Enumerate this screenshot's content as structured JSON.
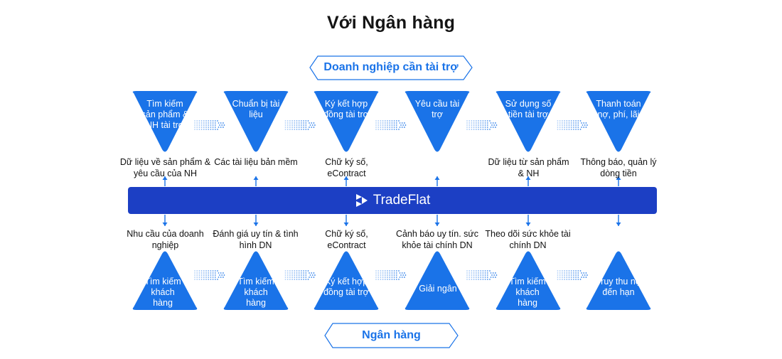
{
  "title": "Với Ngân hàng",
  "top_header": "Doanh nghiệp cần tài trợ",
  "bottom_header": "Ngân hàng",
  "platform": "TradeFlat",
  "colors": {
    "accent": "#1a73e8",
    "bar": "#1c3fc4",
    "text": "#111111"
  },
  "top_steps": [
    {
      "text": "Tìm kiếm sản phẩm & NH tài trợ"
    },
    {
      "text": "Chuẩn bị tài liệu"
    },
    {
      "text": "Ký kết hợp đồng tài trợ"
    },
    {
      "text": "Yêu cầu tài trợ"
    },
    {
      "text": "Sử dụng số tiền tài trợ"
    },
    {
      "text": "Thanh toán nợ, phí, lãi"
    }
  ],
  "top_labels": [
    "Dữ liệu về sản phẩm & yêu cầu của NH",
    "Các tài liệu bản mềm",
    "Chữ ký số, eContract",
    "",
    "Dữ liệu từ sản phẩm & NH",
    "Thông báo, quản lý dòng tiền"
  ],
  "bottom_labels": [
    "Nhu cầu của doanh nghiệp",
    "Đánh giá uy tín & tình hình DN",
    "Chữ ký số, eContract",
    "Cảnh báo uy tín. sức khỏe tài chính DN",
    "Theo dõi sức khỏe tài chính DN",
    ""
  ],
  "bottom_steps": [
    {
      "text": "Tìm kiếm khách hàng"
    },
    {
      "text": "Tìm kiếm khách hàng"
    },
    {
      "text": "Ký kết hợp đồng tài trợ"
    },
    {
      "text": "Giải ngân"
    },
    {
      "text": "Tìm kiếm khách hàng"
    },
    {
      "text": "Truy thu nợ đến hạn"
    }
  ]
}
